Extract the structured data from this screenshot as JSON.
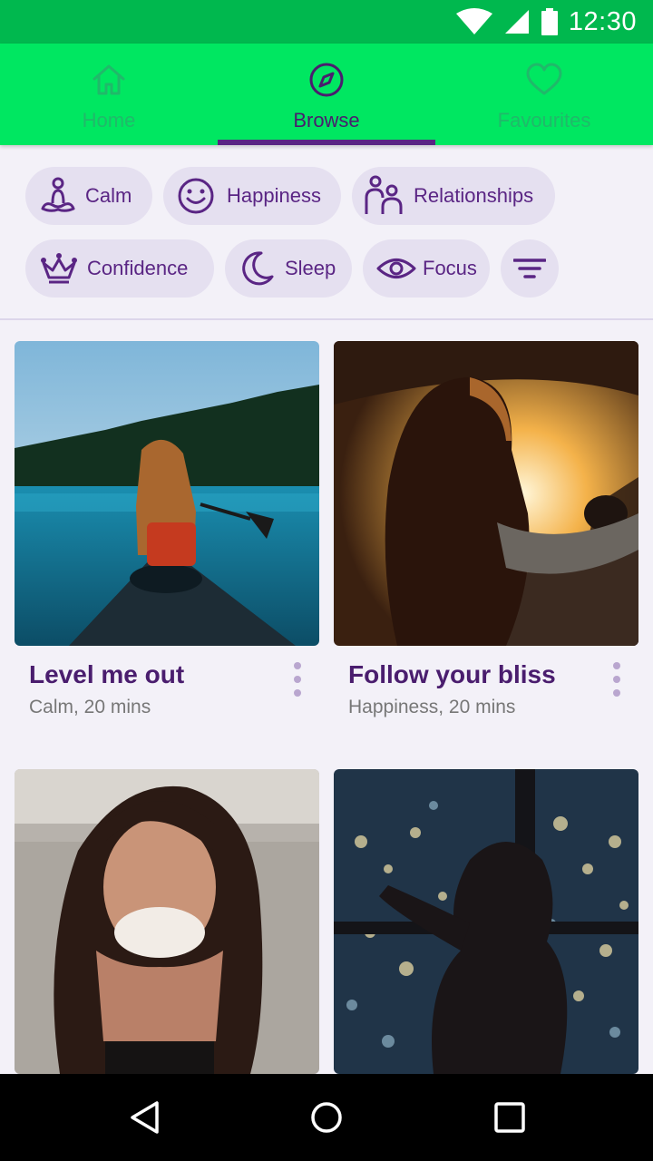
{
  "status": {
    "time": "12:30"
  },
  "tabs": [
    {
      "label": "Home",
      "icon": "home-icon",
      "active": false
    },
    {
      "label": "Browse",
      "icon": "compass-icon",
      "active": true
    },
    {
      "label": "Favourites",
      "icon": "heart-icon",
      "active": false
    }
  ],
  "chips": [
    {
      "label": "Calm",
      "icon": "meditation-icon"
    },
    {
      "label": "Happiness",
      "icon": "smiley-icon"
    },
    {
      "label": "Relationships",
      "icon": "people-icon"
    },
    {
      "label": "Confidence",
      "icon": "crown-icon"
    },
    {
      "label": "Sleep",
      "icon": "moon-icon"
    },
    {
      "label": "Focus",
      "icon": "eye-icon"
    }
  ],
  "filter": {
    "icon": "filter-icon"
  },
  "cards": [
    {
      "title": "Level me out",
      "subtitle": "Calm, 20 mins"
    },
    {
      "title": "Follow your bliss",
      "subtitle": "Happiness, 20 mins"
    },
    {
      "title": "",
      "subtitle": ""
    },
    {
      "title": "",
      "subtitle": ""
    }
  ],
  "colors": {
    "status_bar": "#00b84e",
    "app_bar": "#00e761",
    "accent": "#5a2584",
    "chip_bg": "#e5e0f0"
  }
}
